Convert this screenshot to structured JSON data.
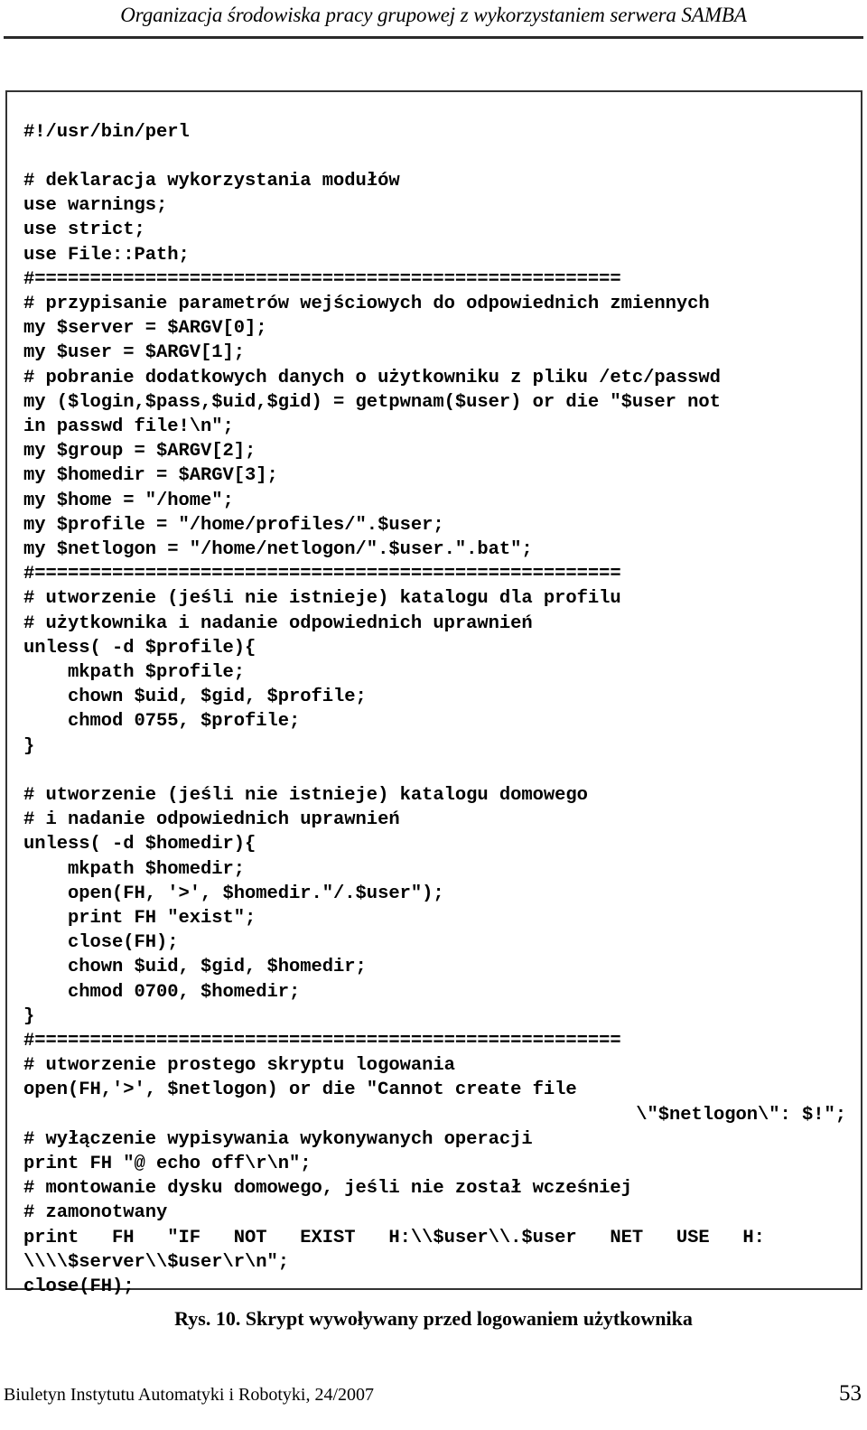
{
  "header": {
    "title": "Organizacja środowiska pracy grupowej z wykorzystaniem serwera SAMBA"
  },
  "figure": {
    "language": "perl",
    "caption": "Rys. 10. Skrypt wywoływany przed logowaniem użytkownika",
    "code_lines": [
      "#!/usr/bin/perl",
      "",
      "# deklaracja wykorzystania modułów",
      "use warnings;",
      "use strict;",
      "use File::Path;",
      "#=====================================================",
      "# przypisanie parametrów wejściowych do odpowiednich zmiennych",
      "my $server = $ARGV[0];",
      "my $user = $ARGV[1];",
      "# pobranie dodatkowych danych o użytkowniku z pliku /etc/passwd",
      "my ($login,$pass,$uid,$gid) = getpwnam($user) or die \"$user not",
      "in passwd file!\\n\";",
      "my $group = $ARGV[2];",
      "my $homedir = $ARGV[3];",
      "my $home = \"/home\";",
      "my $profile = \"/home/profiles/\".$user;",
      "my $netlogon = \"/home/netlogon/\".$user.\".bat\";",
      "#=====================================================",
      "# utworzenie (jeśli nie istnieje) katalogu dla profilu",
      "# użytkownika i nadanie odpowiednich uprawnień",
      "unless( -d $profile){",
      "    mkpath $profile;",
      "    chown $uid, $gid, $profile;",
      "    chmod 0755, $profile;",
      "}",
      "",
      "# utworzenie (jeśli nie istnieje) katalogu domowego",
      "# i nadanie odpowiednich uprawnień",
      "unless( -d $homedir){",
      "    mkpath $homedir;",
      "    open(FH, '>', $homedir.\"/.$user\");",
      "    print FH \"exist\";",
      "    close(FH);",
      "    chown $uid, $gid, $homedir;",
      "    chmod 0700, $homedir;",
      "}",
      "#=====================================================",
      "# utworzenie prostego skryptu logowania",
      "open(FH,'>', $netlogon) or die \"Cannot create file",
      "\\\"$netlogon\\\": $!\";",
      "# wyłączenie wypisywania wykonywanych operacji",
      "print FH \"@ echo off\\r\\n\";",
      "# montowanie dysku domowego, jeśli nie został wcześniej",
      "# zamonotwany",
      "print   FH   \"IF   NOT   EXIST   H:\\\\$user\\\\.$user   NET   USE   H:",
      "\\\\\\\\$server\\\\$user\\r\\n\";",
      "close(FH);"
    ],
    "right_aligned_line_index": 40
  },
  "footer": {
    "text": "Biuletyn Instytutu Automatyki i Robotyki, 24/2007",
    "page_number": "53"
  },
  "colors": {
    "text": "#000000",
    "rule": "#2a2a2a",
    "box_border": "#333333",
    "background": "#ffffff"
  }
}
